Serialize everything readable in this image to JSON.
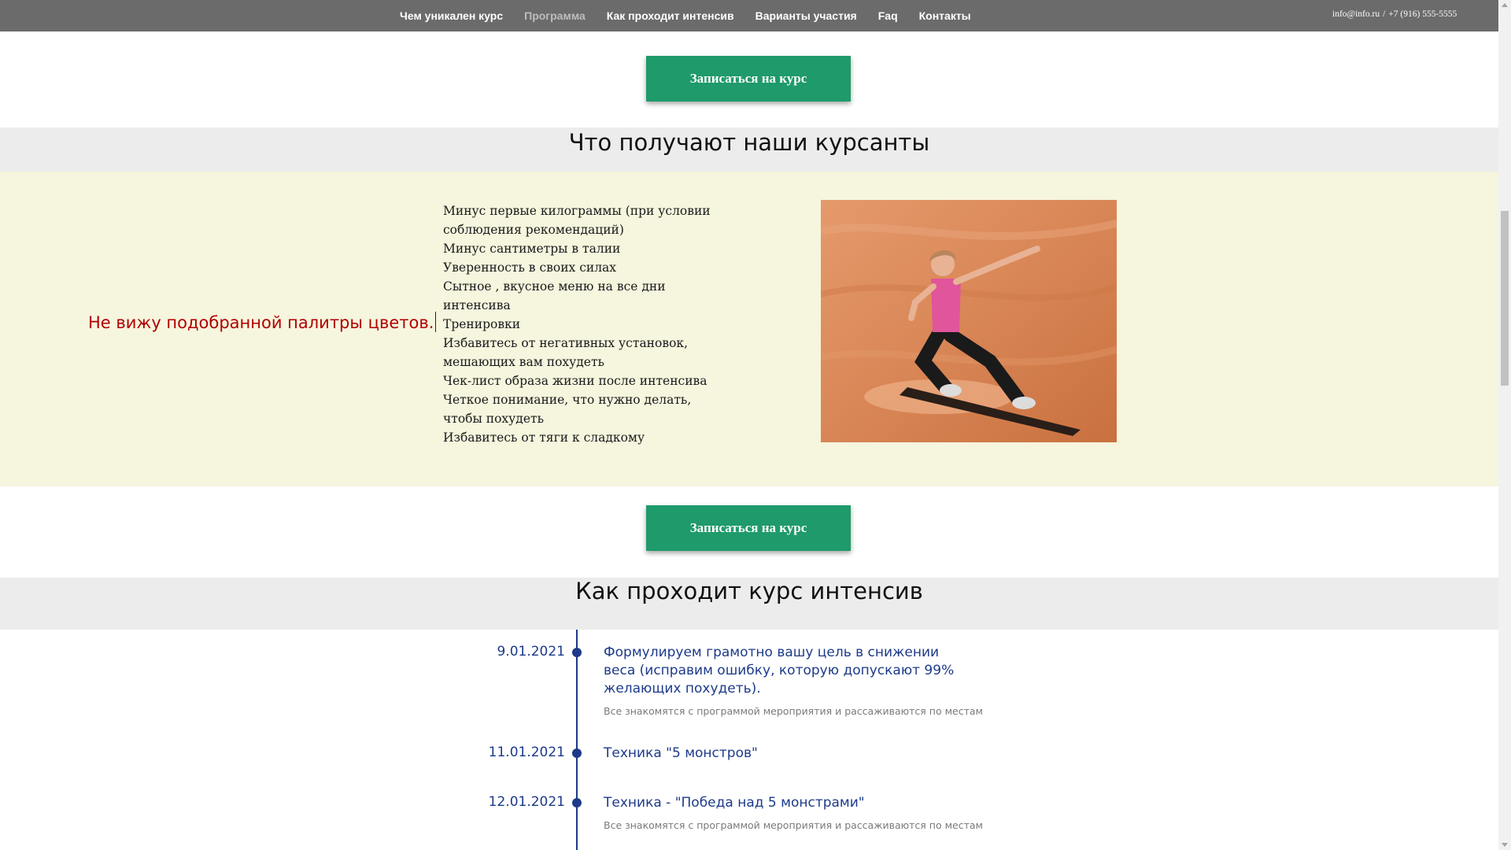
{
  "nav": {
    "items": [
      {
        "label": "Чем уникален курс",
        "active": false
      },
      {
        "label": "Программа",
        "active": true
      },
      {
        "label": "Как проходит интенсив",
        "active": false
      },
      {
        "label": "Варианты участия",
        "active": false
      },
      {
        "label": "Faq",
        "active": false
      },
      {
        "label": "Контакты",
        "active": false
      }
    ],
    "email": "info@info.ru",
    "separator": "/",
    "phone": "+7 (916) 555-5555"
  },
  "cta": {
    "label": "Записаться на курс"
  },
  "benefits": {
    "heading": "Что получают наши курсанты",
    "note": "Не вижу подобранной палитры цветов.",
    "items": [
      "Минус первые килограммы (при условии соблюдения рекомендаций)",
      "Минус сантиметры в талии",
      "Уверенность в своих силах",
      "Сытное , вкусное меню на все дни интенсива",
      "Тренировки",
      "Избавитесь от негативных установок, мешающих вам похудеть",
      "Чек-лист образа жизни после интенсива",
      "Четкое понимание, что нужно делать, чтобы похудеть",
      "Избавитесь от тяги к сладкому"
    ],
    "image": "sandboarding-woman-photo"
  },
  "course": {
    "heading": "Как проходит курс интенсив",
    "timeline": [
      {
        "date": "9.01.2021",
        "title": "Формулируем грамотно вашу цель в снижении веса (исправим ошибку, которую допускают 99% желающих похудеть).",
        "desc": "Все знакомятся с программой мероприятия и рассаживаются по местам"
      },
      {
        "date": "11.01.2021",
        "title": "Техника \"5 монстров\"",
        "desc": ""
      },
      {
        "date": "12.01.2021",
        "title": "Техника - \"Победа над 5 монстрами\"",
        "desc": "Все знакомятся с программой мероприятия и рассаживаются по местам"
      }
    ]
  },
  "colors": {
    "nav_bg": "#6b6b6b",
    "cta_bg": "#1f9a6a",
    "section_head_bg": "#ececec",
    "benefits_bg": "#f6f5de",
    "note_text": "#b00000",
    "timeline_accent": "#1d3a8a"
  }
}
